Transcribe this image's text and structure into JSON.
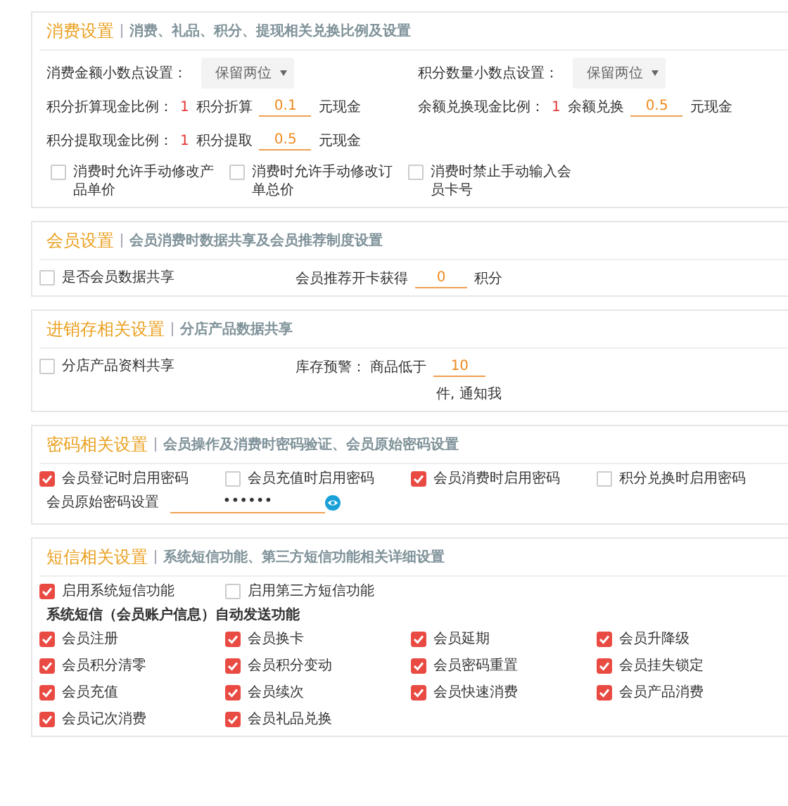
{
  "sections": [
    {
      "kind": "consume",
      "title": "消费设置",
      "subtitle": "消费、礼品、积分、提现相关兑换比例及设置",
      "selects": [
        {
          "label": "消费金额小数点设置：",
          "value": "保留两位"
        },
        {
          "label": "积分数量小数点设置：",
          "value": "保留两位"
        }
      ],
      "ratios": [
        {
          "label": "积分折算现金比例：",
          "one": "1",
          "prefix": "积分折算",
          "value": "0.1",
          "suffix": "元现金"
        },
        {
          "label": "余额兑换现金比例：",
          "one": "1",
          "prefix": "余额兑换",
          "value": "0.5",
          "suffix": "元现金"
        },
        {
          "label": "积分提取现金比例：",
          "one": "1",
          "prefix": "积分提取",
          "value": "0.5",
          "suffix": "元现金"
        }
      ],
      "checkboxes": [
        {
          "label": "消费时允许手动修改产品单价",
          "checked": false
        },
        {
          "label": "消费时允许手动修改订单总价",
          "checked": false
        },
        {
          "label": "消费时禁止手动输入会员卡号",
          "checked": false
        }
      ]
    },
    {
      "kind": "member",
      "title": "会员设置",
      "subtitle": "会员消费时数据共享及会员推荐制度设置",
      "checkboxes": [
        {
          "label": "是否会员数据共享",
          "checked": false
        }
      ],
      "field": {
        "label": "会员推荐开卡获得",
        "value": "0",
        "suffix": "积分"
      }
    },
    {
      "kind": "stock",
      "title": "进销存相关设置",
      "subtitle": "分店产品数据共享",
      "checkboxes": [
        {
          "label": "分店产品资料共享",
          "checked": false
        }
      ],
      "field": {
        "label": "库存预警：  商品低于",
        "value": "10",
        "suffix": "件, 通知我"
      }
    },
    {
      "kind": "password",
      "title": "密码相关设置",
      "subtitle": "会员操作及消费时密码验证、会员原始密码设置",
      "checkboxes": [
        {
          "label": "会员登记时启用密码",
          "checked": true
        },
        {
          "label": "会员充值时启用密码",
          "checked": false
        },
        {
          "label": "会员消费时启用密码",
          "checked": true
        },
        {
          "label": "积分兑换时启用密码",
          "checked": false
        }
      ],
      "field": {
        "label": "会员原始密码设置",
        "value": "••••••"
      }
    },
    {
      "kind": "sms",
      "title": "短信相关设置",
      "subtitle": "系统短信功能、第三方短信功能相关详细设置",
      "checkboxes": [
        {
          "label": "启用系统短信功能",
          "checked": true
        },
        {
          "label": "启用第三方短信功能",
          "checked": false
        }
      ],
      "heading": "系统短信（会员账户信息）自动发送功能",
      "options": [
        {
          "label": "会员注册",
          "checked": true
        },
        {
          "label": "会员换卡",
          "checked": true
        },
        {
          "label": "会员延期",
          "checked": true
        },
        {
          "label": "会员升降级",
          "checked": true
        },
        {
          "label": "会员积分清零",
          "checked": true
        },
        {
          "label": "会员积分变动",
          "checked": true
        },
        {
          "label": "会员密码重置",
          "checked": true
        },
        {
          "label": "会员挂失锁定",
          "checked": true
        },
        {
          "label": "会员充值",
          "checked": true
        },
        {
          "label": "会员续次",
          "checked": true
        },
        {
          "label": "会员快速消费",
          "checked": true
        },
        {
          "label": "会员产品消费",
          "checked": true
        },
        {
          "label": "会员记次消费",
          "checked": true
        },
        {
          "label": "会员礼品兑换",
          "checked": true
        }
      ]
    }
  ]
}
